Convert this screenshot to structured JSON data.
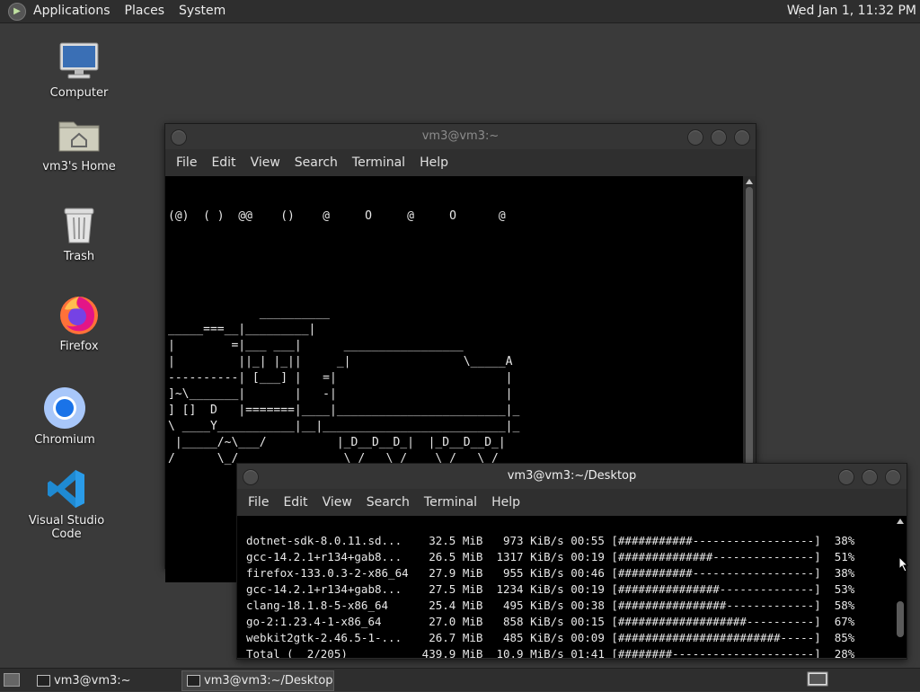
{
  "top_panel": {
    "menus": [
      "Applications",
      "Places",
      "System"
    ],
    "clock": "Wed Jan  1, 11:32 PM"
  },
  "desktop_icons": [
    "Computer",
    "vm3's Home",
    "Trash",
    "Firefox",
    "Chromium",
    "Visual Studio Code"
  ],
  "window1": {
    "title": "vm3@vm3:~",
    "menu": [
      "File",
      "Edit",
      "View",
      "Search",
      "Terminal",
      "Help"
    ],
    "lines": [
      "(@)  ( )  @@    ()    @     O     @     O      @",
      "",
      "",
      "",
      "",
      "",
      "             __________",
      "_____===__|_________|",
      "|        =|___ ___|      _________________",
      "|         ||_| |_||     _|                \\_____A",
      "----------| [___] |   =|                        |",
      "]~\\_______|       |   -|                        |",
      "] []  D   |=======|____|________________________|_",
      "\\ ____Y___________|__|__________________________|_",
      " |_____/~\\___/          |_D__D__D_|  |_D__D__D_|",
      "/      \\_/               \\_/   \\_/    \\_/   \\_/"
    ]
  },
  "window2": {
    "title": "vm3@vm3:~/Desktop",
    "menu": [
      "File",
      "Edit",
      "View",
      "Search",
      "Terminal",
      "Help"
    ],
    "lines": [
      "dotnet-sdk-8.0.11.sd...    32.5 MiB   973 KiB/s 00:55 [###########------------------]  38%",
      "gcc-14.2.1+r134+gab8...    26.5 MiB  1317 KiB/s 00:19 [##############---------------]  51%",
      "firefox-133.0.3-2-x86_64   27.9 MiB   955 KiB/s 00:46 [###########------------------]  38%",
      "gcc-14.2.1+r134+gab8...    27.5 MiB  1234 KiB/s 00:19 [###############--------------]  53%",
      "clang-18.1.8-5-x86_64      25.4 MiB   495 KiB/s 00:38 [################-------------]  58%",
      "go-2:1.23.4-1-x86_64       27.0 MiB   858 KiB/s 00:15 [###################----------]  67%",
      "webkit2gtk-2.46.5-1-...    26.7 MiB   485 KiB/s 00:09 [########################-----]  85%",
      "Total (  2/205)           439.9 MiB  10.9 MiB/s 01:41 [########---------------------]  28%"
    ]
  },
  "taskbar": [
    "vm3@vm3:~",
    "vm3@vm3:~/Desktop"
  ]
}
